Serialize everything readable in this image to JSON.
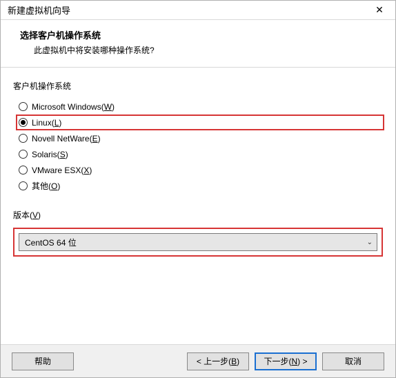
{
  "window": {
    "title": "新建虚拟机向导",
    "close_icon": "✕"
  },
  "header": {
    "title": "选择客户机操作系统",
    "subtitle": "此虚拟机中将安装哪种操作系统?"
  },
  "guest_os": {
    "label": "客户机操作系统",
    "options": [
      {
        "text": "Microsoft Windows(",
        "hotkey": "W",
        "suffix": ")",
        "checked": false,
        "highlight": false
      },
      {
        "text": "Linux(",
        "hotkey": "L",
        "suffix": ")",
        "checked": true,
        "highlight": true
      },
      {
        "text": "Novell NetWare(",
        "hotkey": "E",
        "suffix": ")",
        "checked": false,
        "highlight": false
      },
      {
        "text": "Solaris(",
        "hotkey": "S",
        "suffix": ")",
        "checked": false,
        "highlight": false
      },
      {
        "text": "VMware ESX(",
        "hotkey": "X",
        "suffix": ")",
        "checked": false,
        "highlight": false
      },
      {
        "text": "其他(",
        "hotkey": "O",
        "suffix": ")",
        "checked": false,
        "highlight": false
      }
    ]
  },
  "version": {
    "label_prefix": "版本(",
    "label_hotkey": "V",
    "label_suffix": ")",
    "selected": "CentOS 64 位"
  },
  "buttons": {
    "help": "帮助",
    "back_prefix": "< 上一步(",
    "back_hotkey": "B",
    "back_suffix": ")",
    "next_prefix": "下一步(",
    "next_hotkey": "N",
    "next_suffix": ") >",
    "cancel": "取消"
  }
}
